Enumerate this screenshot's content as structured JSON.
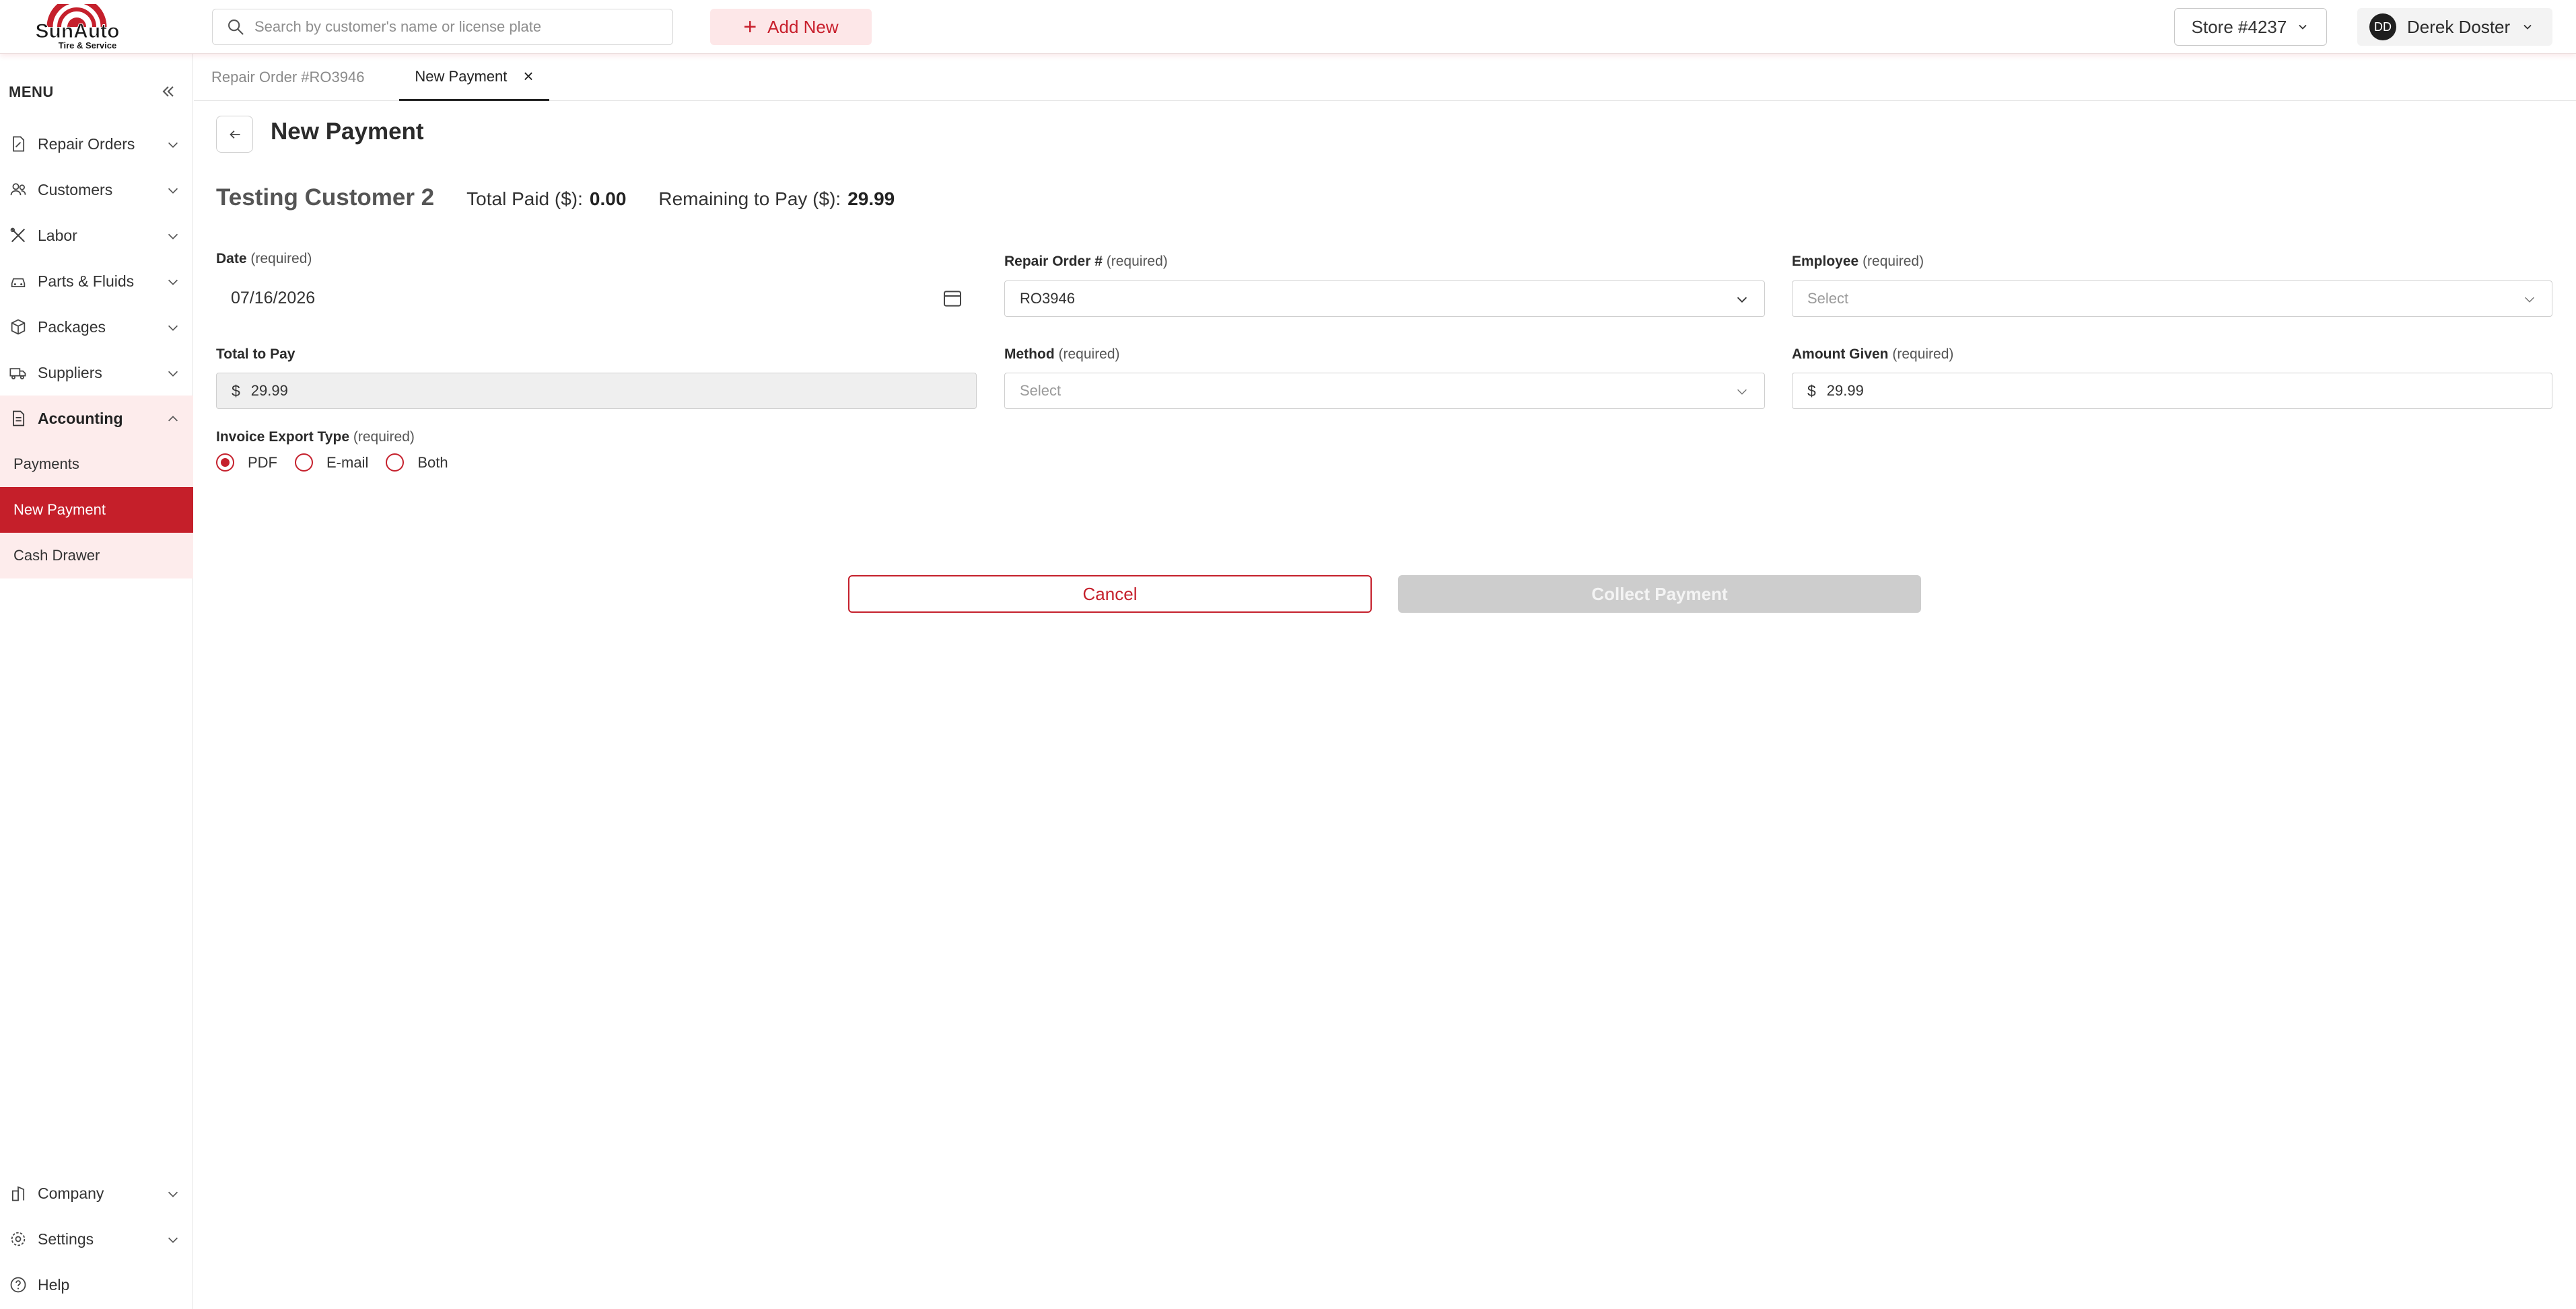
{
  "header": {
    "logo_text": "SunAuto",
    "logo_subtext": "Tire & Service",
    "search_placeholder": "Search by customer's name or license plate",
    "add_new_label": "Add New",
    "store_label": "Store #4237",
    "user_initials": "DD",
    "user_name": "Derek Doster"
  },
  "sidebar": {
    "menu_label": "MENU",
    "items": [
      {
        "label": "Repair Orders",
        "icon": "document-edit-icon"
      },
      {
        "label": "Customers",
        "icon": "users-icon"
      },
      {
        "label": "Labor",
        "icon": "tools-icon"
      },
      {
        "label": "Parts & Fluids",
        "icon": "car-icon"
      },
      {
        "label": "Packages",
        "icon": "package-icon"
      },
      {
        "label": "Suppliers",
        "icon": "truck-icon"
      },
      {
        "label": "Accounting",
        "icon": "ledger-icon"
      }
    ],
    "sub_items": [
      "Payments",
      "New Payment",
      "Cash Drawer"
    ],
    "bottom_items": [
      {
        "label": "Company",
        "icon": "building-icon"
      },
      {
        "label": "Settings",
        "icon": "gear-icon"
      },
      {
        "label": "Help",
        "icon": "help-icon"
      }
    ]
  },
  "tabs": [
    {
      "label": "Repair Order #RO3946"
    },
    {
      "label": "New Payment"
    }
  ],
  "page": {
    "title": "New Payment",
    "customer_name": "Testing Customer 2",
    "total_paid_label": "Total Paid ($):",
    "total_paid_value": "0.00",
    "remaining_label": "Remaining to Pay ($):",
    "remaining_value": "29.99"
  },
  "form": {
    "required_text": "(required)",
    "date": {
      "label": "Date",
      "value": "07/16/2026"
    },
    "repair_order": {
      "label": "Repair Order #",
      "value": "RO3946"
    },
    "employee": {
      "label": "Employee",
      "placeholder": "Select"
    },
    "total_to_pay": {
      "label": "Total to Pay",
      "currency": "$",
      "value": "29.99"
    },
    "method": {
      "label": "Method",
      "placeholder": "Select"
    },
    "amount_given": {
      "label": "Amount Given",
      "currency": "$",
      "value": "29.99"
    },
    "invoice_export": {
      "label": "Invoice Export Type",
      "options": [
        "PDF",
        "E-mail",
        "Both"
      ],
      "selected": "PDF"
    }
  },
  "actions": {
    "cancel_label": "Cancel",
    "collect_label": "Collect Payment"
  },
  "colors": {
    "brand": "#c5202c",
    "brand_light": "#fdecec",
    "disabled": "#cdcdcd"
  }
}
